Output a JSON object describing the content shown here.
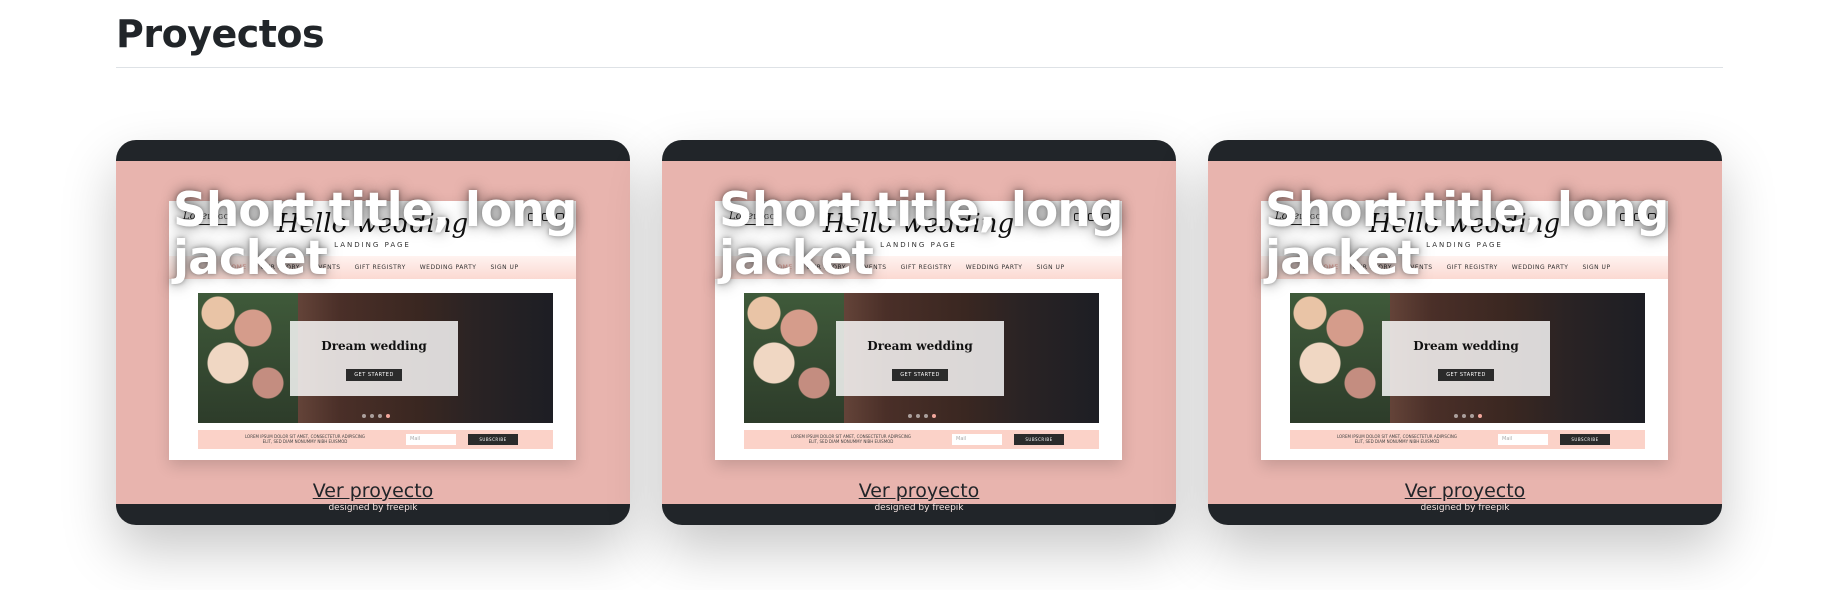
{
  "section": {
    "title": "Proyectos"
  },
  "projects": [
    {
      "overlay_title": "Short title, long jacket",
      "link_label": "Ver proyecto",
      "credit": "designed by freepik",
      "preview": {
        "logo": "Love",
        "logo_suffix": "LOGO",
        "brand": "Hello wedding",
        "brand_sub": "LANDING PAGE",
        "nav": [
          "HOME",
          "OUR STORY",
          "EVENTS",
          "GIFT REGISTRY",
          "WEDDING PARTY",
          "SIGN UP"
        ],
        "hero_title": "Dream wedding",
        "hero_button": "GET STARTED",
        "footer_text": "LOREM IPSUM DOLOR SIT AMET, CONSECTETUR ADIPISCING ELIT, SED DIAM NONUMMY NIBH EUISMOD",
        "footer_placeholder": "Mail",
        "footer_button": "SUBSCRIBE"
      }
    },
    {
      "overlay_title": "Short title, long jacket",
      "link_label": "Ver proyecto",
      "credit": "designed by freepik",
      "preview": {
        "logo": "Love",
        "logo_suffix": "LOGO",
        "brand": "Hello wedding",
        "brand_sub": "LANDING PAGE",
        "nav": [
          "HOME",
          "OUR STORY",
          "EVENTS",
          "GIFT REGISTRY",
          "WEDDING PARTY",
          "SIGN UP"
        ],
        "hero_title": "Dream wedding",
        "hero_button": "GET STARTED",
        "footer_text": "LOREM IPSUM DOLOR SIT AMET, CONSECTETUR ADIPISCING ELIT, SED DIAM NONUMMY NIBH EUISMOD",
        "footer_placeholder": "Mail",
        "footer_button": "SUBSCRIBE"
      }
    },
    {
      "overlay_title": "Short title, long jacket",
      "link_label": "Ver proyecto",
      "credit": "designed by freepik",
      "preview": {
        "logo": "Love",
        "logo_suffix": "LOGO",
        "brand": "Hello wedding",
        "brand_sub": "LANDING PAGE",
        "nav": [
          "HOME",
          "OUR STORY",
          "EVENTS",
          "GIFT REGISTRY",
          "WEDDING PARTY",
          "SIGN UP"
        ],
        "hero_title": "Dream wedding",
        "hero_button": "GET STARTED",
        "footer_text": "LOREM IPSUM DOLOR SIT AMET, CONSECTETUR ADIPISCING ELIT, SED DIAM NONUMMY NIBH EUISMOD",
        "footer_placeholder": "Mail",
        "footer_button": "SUBSCRIBE"
      }
    }
  ],
  "colors": {
    "card_frame": "#e8b4ae",
    "card_border": "#212529",
    "heading": "#212529"
  }
}
